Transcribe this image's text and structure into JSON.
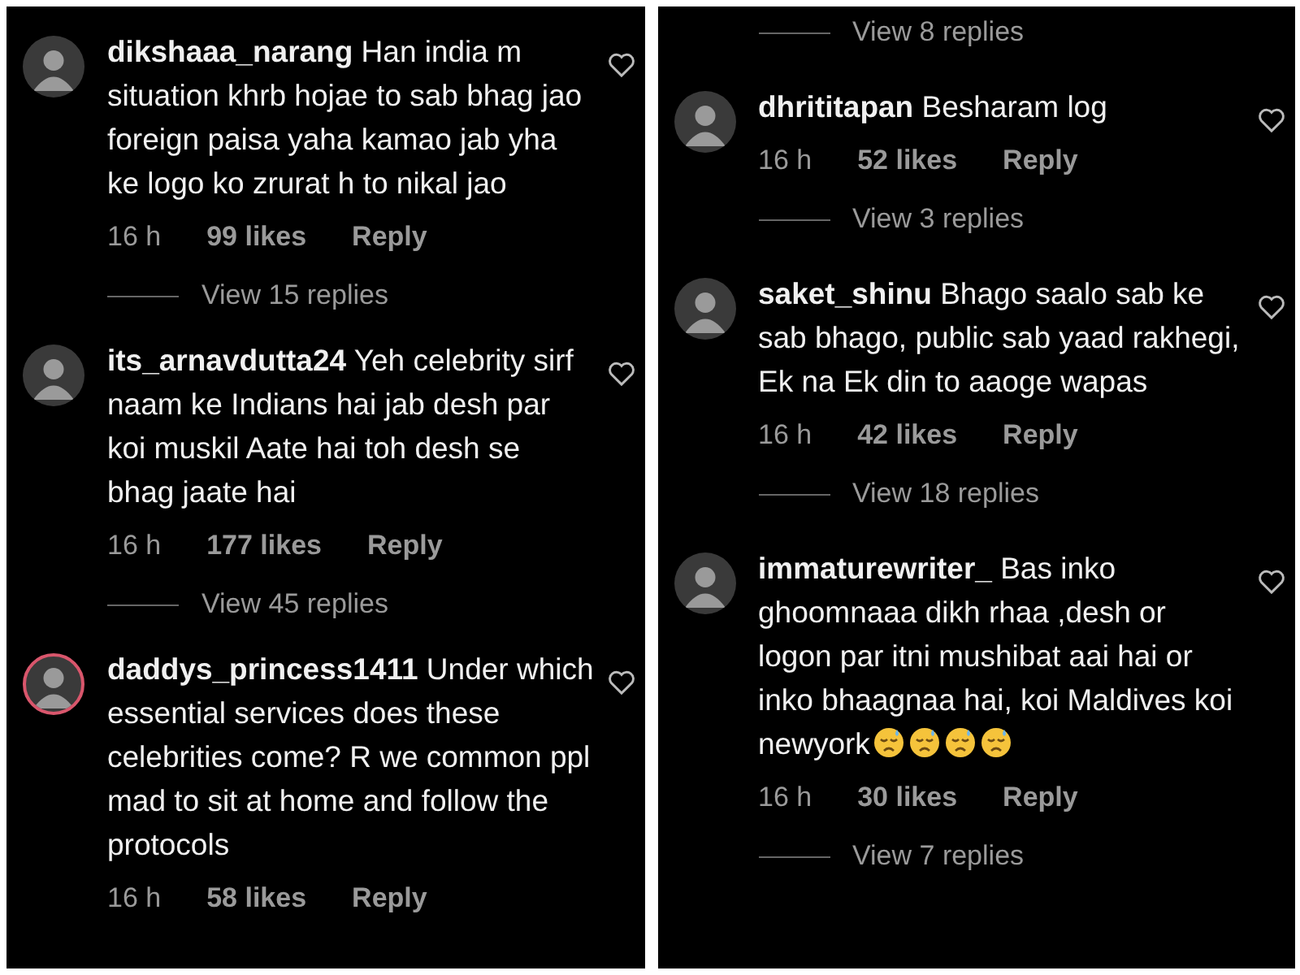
{
  "panels": [
    {
      "items": [
        {
          "kind": "comment",
          "username": "dikshaaa_narang",
          "text": "Han india m situation khrb hojae to sab bhag jao foreign paisa yaha kamao jab yha ke logo ko zrurat h to nikal jao",
          "story_ring": false,
          "time": "16 h",
          "likes": "99 likes",
          "reply": "Reply",
          "view_replies": "View 15 replies"
        },
        {
          "kind": "comment",
          "username": "its_arnavdutta24",
          "text": "Yeh celebrity sirf naam ke Indians hai jab desh par koi muskil Aate hai toh desh se bhag jaate hai",
          "story_ring": false,
          "time": "16 h",
          "likes": "177 likes",
          "reply": "Reply",
          "view_replies": "View 45 replies"
        },
        {
          "kind": "comment",
          "username": "daddys_princess1411",
          "text": "Under which essential services does these celebrities come? R we common ppl mad to sit at home and follow the protocols",
          "story_ring": true,
          "time": "16 h",
          "likes": "58 likes",
          "reply": "Reply"
        }
      ]
    },
    {
      "items": [
        {
          "kind": "view_replies",
          "label": "View 8 replies"
        },
        {
          "kind": "comment",
          "username": "dhrititapan",
          "text": "Besharam log",
          "story_ring": false,
          "time": "16 h",
          "likes": "52 likes",
          "reply": "Reply",
          "view_replies": "View 3 replies"
        },
        {
          "kind": "comment",
          "username": "saket_shinu",
          "text": "Bhago saalo sab ke sab bhago, public sab yaad rakhegi, Ek na Ek din to aaoge wapas",
          "story_ring": false,
          "time": "16 h",
          "likes": "42 likes",
          "reply": "Reply",
          "view_replies": "View 18 replies"
        },
        {
          "kind": "comment",
          "username": "immaturewriter_",
          "text": "Bas inko ghoomnaaa dikh rhaa ,desh or logon par itni mushibat aai hai or inko bhaagnaa hai, koi Maldives koi newyork",
          "emojis": [
            {
              "kind": "downcast-sweat"
            },
            {
              "kind": "downcast-sweat"
            },
            {
              "kind": "downcast-sweat"
            },
            {
              "kind": "downcast-sweat"
            }
          ],
          "story_ring": false,
          "time": "16 h",
          "likes": "30 likes",
          "reply": "Reply",
          "view_replies": "View 7 replies"
        }
      ]
    }
  ]
}
